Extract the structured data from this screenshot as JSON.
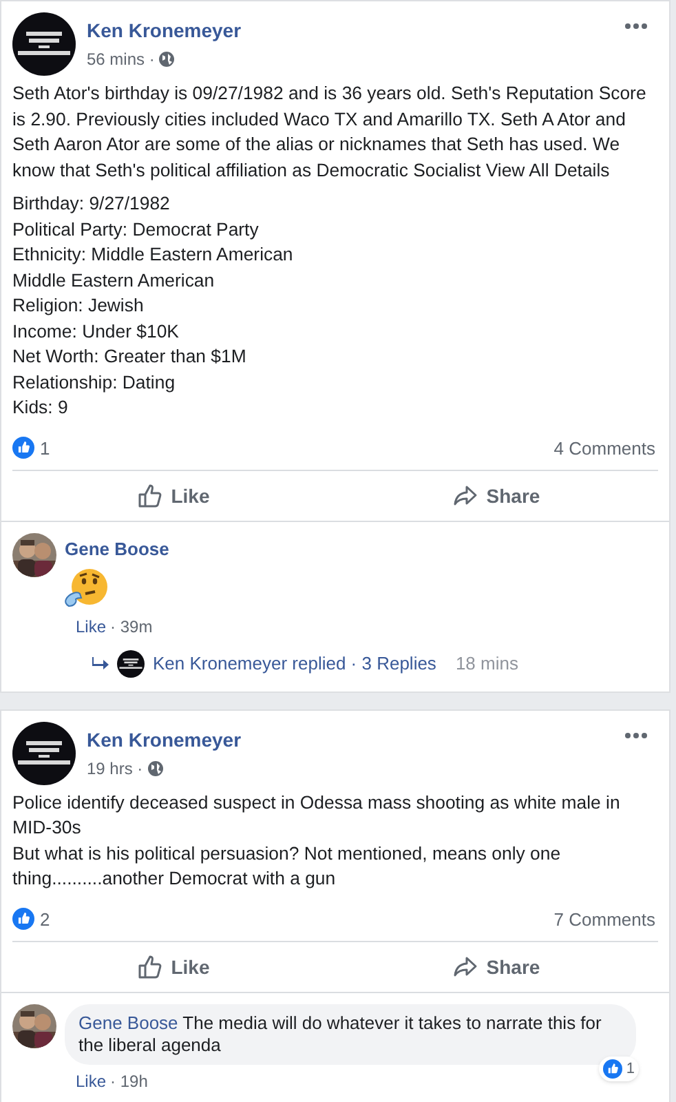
{
  "posts": [
    {
      "author": "Ken Kronemeyer",
      "time": "56 mins ·",
      "paragraphs": [
        "Seth Ator's birthday is 09/27/1982 and is 36 years old. Seth's Reputation Score is 2.90. Previously cities included Waco TX and Amarillo TX. Seth A Ator and Seth Aaron Ator are some of the alias or nicknames that Seth has used. We know that Seth's political affiliation as Democratic Socialist View All Details",
        "Birthday: 9/27/1982\nPolitical Party: Democrat Party\nEthnicity: Middle Eastern American\nMiddle Eastern American\nReligion: Jewish\nIncome: Under $10K\nNet Worth: Greater than $1M\nRelationship: Dating\nKids: 9"
      ],
      "likes": "1",
      "comments_count": "4 Comments",
      "actions": [
        "Like",
        "Share"
      ],
      "comments": [
        {
          "kind": "sticker",
          "author": "Gene Boose",
          "like": "Like",
          "time": "· 39m",
          "reply": {
            "text": "Ken Kronemeyer replied · 3 Replies",
            "time": "18 mins"
          }
        }
      ]
    },
    {
      "author": "Ken Kronemeyer",
      "time": "19 hrs ·",
      "paragraphs": [
        "Police identify deceased suspect in Odessa mass shooting as white male in MID-30s\nBut what is his political persuasion? Not mentioned, means only one thing..........another Democrat with a gun"
      ],
      "likes": "2",
      "comments_count": "7 Comments",
      "actions": [
        "Like",
        "Share"
      ],
      "comments": [
        {
          "kind": "text",
          "author": "Gene Boose",
          "text": "The media will do whatever it takes to narrate this for the liberal agenda",
          "like": "Like",
          "time": "· 19h",
          "reactions": "1"
        }
      ]
    }
  ]
}
